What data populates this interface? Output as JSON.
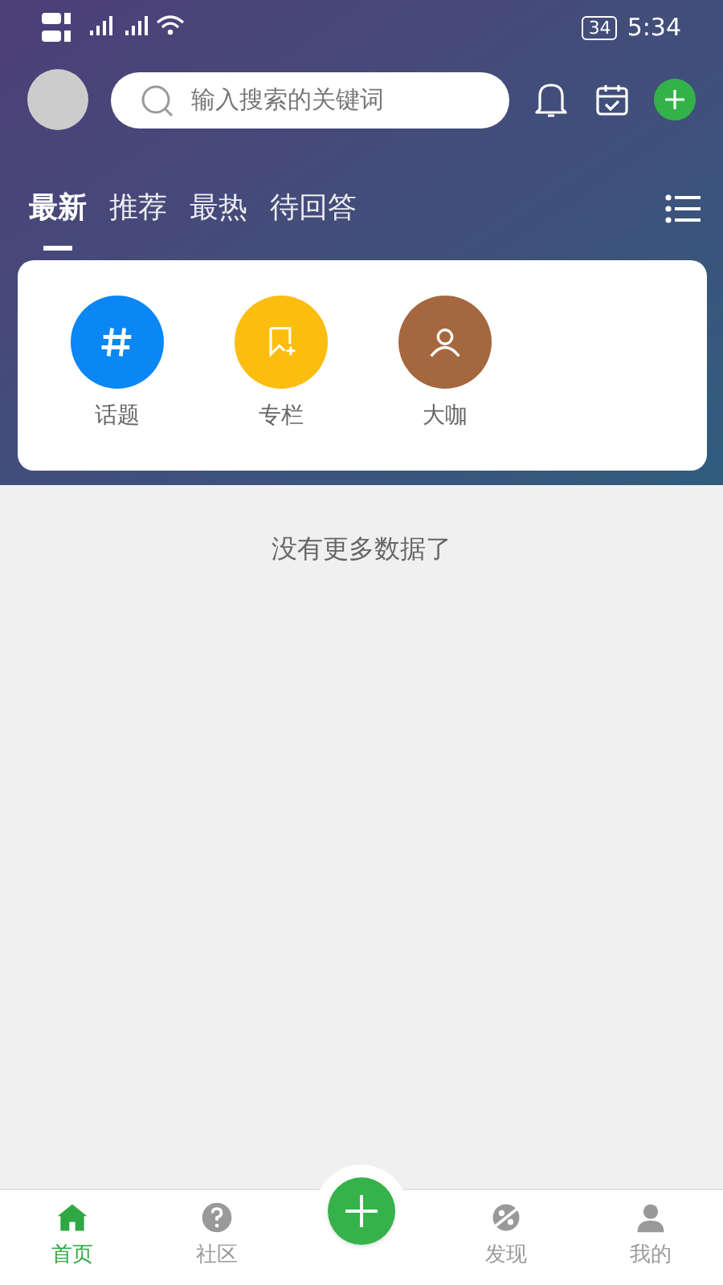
{
  "status_bar": {
    "battery": "34",
    "time": "5:34"
  },
  "search": {
    "placeholder": "输入搜索的关键词"
  },
  "tabs": [
    {
      "label": "最新",
      "selected": true
    },
    {
      "label": "推荐",
      "selected": false
    },
    {
      "label": "最热",
      "selected": false
    },
    {
      "label": "待回答",
      "selected": false
    }
  ],
  "categories": [
    {
      "label": "话题",
      "kind": "hash",
      "color": "#0a86f5"
    },
    {
      "label": "专栏",
      "kind": "bookmark",
      "color": "#fbbd0f"
    },
    {
      "label": "大咖",
      "kind": "person",
      "color": "#a5673f"
    }
  ],
  "empty_message": "没有更多数据了",
  "bottom_nav": [
    {
      "kind": "home",
      "label": "首页",
      "selected": true
    },
    {
      "kind": "question",
      "label": "社区",
      "selected": false
    },
    {
      "kind": "add"
    },
    {
      "kind": "discover",
      "label": "发现",
      "selected": false
    },
    {
      "kind": "person",
      "label": "我的",
      "selected": false
    }
  ]
}
